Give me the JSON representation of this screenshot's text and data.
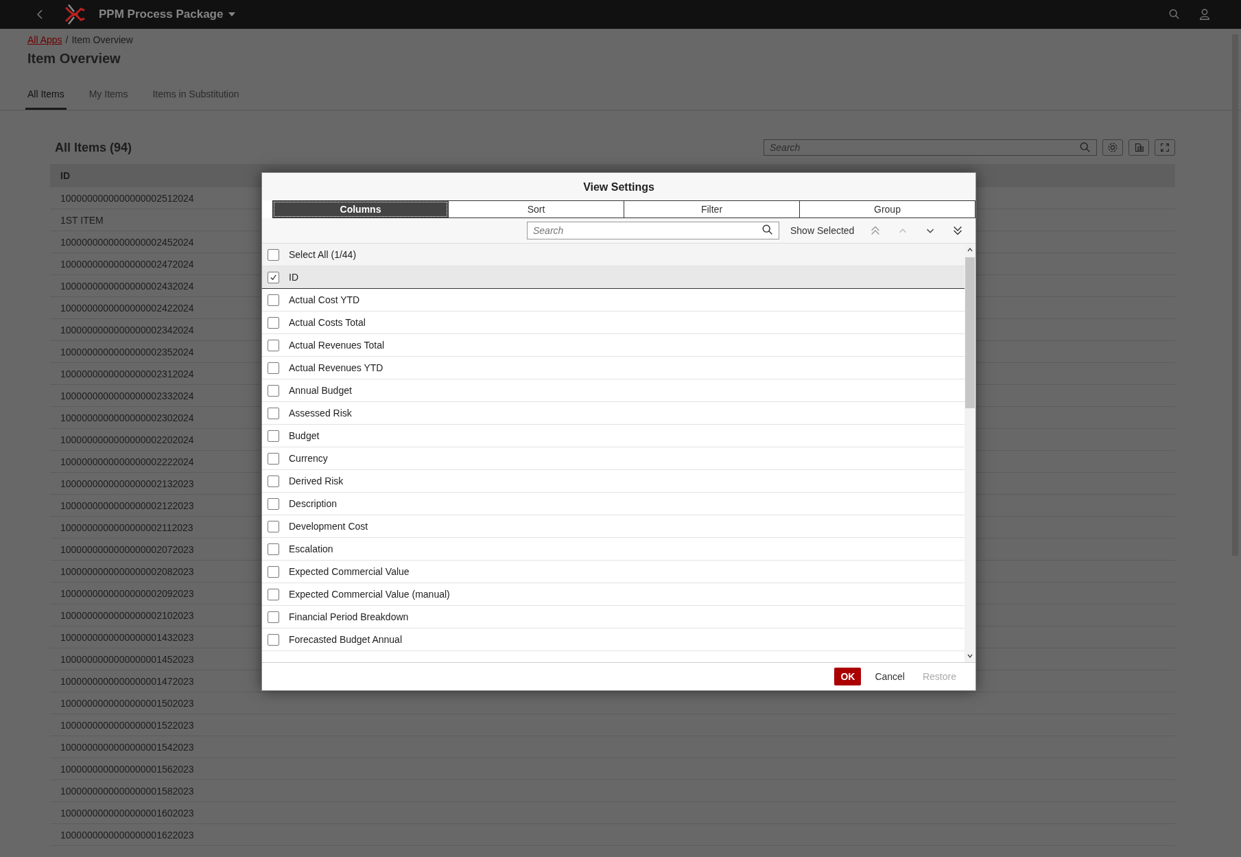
{
  "top_bar": {
    "app_title": "PPM Process Package"
  },
  "breadcrumb": {
    "link": "All Apps",
    "separator": "/",
    "current": "Item Overview"
  },
  "page_title": "Item Overview",
  "tabs": [
    {
      "label": "All Items",
      "selected": true
    },
    {
      "label": "My Items",
      "selected": false
    },
    {
      "label": "Items in Substitution",
      "selected": false
    }
  ],
  "list": {
    "title": "All Items (94)",
    "search": {
      "placeholder": "Search"
    },
    "table": {
      "columns": [
        "ID"
      ],
      "rows": [
        "1000000000000000002512024",
        "1ST ITEM",
        "1000000000000000002452024",
        "1000000000000000002472024",
        "1000000000000000002432024",
        "1000000000000000002422024",
        "1000000000000000002342024",
        "1000000000000000002352024",
        "1000000000000000002312024",
        "1000000000000000002332024",
        "1000000000000000002302024",
        "1000000000000000002202024",
        "1000000000000000002222024",
        "1000000000000000002132023",
        "1000000000000000002122023",
        "1000000000000000002112023",
        "1000000000000000002072023",
        "1000000000000000002082023",
        "1000000000000000002092023",
        "1000000000000000002102023",
        "1000000000000000001432023",
        "1000000000000000001452023",
        "1000000000000000001472023",
        "1000000000000000001502023",
        "1000000000000000001522023",
        "1000000000000000001542023",
        "1000000000000000001562023",
        "1000000000000000001582023",
        "1000000000000000001602023",
        "1000000000000000001622023"
      ]
    }
  },
  "dialog": {
    "title": "View Settings",
    "tabs": [
      {
        "label": "Columns",
        "selected": true
      },
      {
        "label": "Sort",
        "selected": false
      },
      {
        "label": "Filter",
        "selected": false
      },
      {
        "label": "Group",
        "selected": false
      }
    ],
    "search": {
      "placeholder": "Search"
    },
    "show_selected": "Show Selected",
    "select_all": {
      "label": "Select All (1/44)",
      "checked": false
    },
    "columns": [
      {
        "label": "ID",
        "checked": true
      },
      {
        "label": "Actual Cost YTD",
        "checked": false
      },
      {
        "label": "Actual Costs Total",
        "checked": false
      },
      {
        "label": "Actual Revenues Total",
        "checked": false
      },
      {
        "label": "Actual Revenues YTD",
        "checked": false
      },
      {
        "label": "Annual Budget",
        "checked": false
      },
      {
        "label": "Assessed Risk",
        "checked": false
      },
      {
        "label": "Budget",
        "checked": false
      },
      {
        "label": "Currency",
        "checked": false
      },
      {
        "label": "Derived Risk",
        "checked": false
      },
      {
        "label": "Description",
        "checked": false
      },
      {
        "label": "Development Cost",
        "checked": false
      },
      {
        "label": "Escalation",
        "checked": false
      },
      {
        "label": "Expected Commercial Value",
        "checked": false
      },
      {
        "label": "Expected Commercial Value (manual)",
        "checked": false
      },
      {
        "label": "Financial Period Breakdown",
        "checked": false
      },
      {
        "label": "Forecasted Budget Annual",
        "checked": false
      }
    ],
    "buttons": [
      {
        "label": "OK",
        "kind": "primary",
        "disabled": false
      },
      {
        "label": "Cancel",
        "kind": "text",
        "disabled": false
      },
      {
        "label": "Restore",
        "kind": "text",
        "disabled": true
      }
    ]
  }
}
